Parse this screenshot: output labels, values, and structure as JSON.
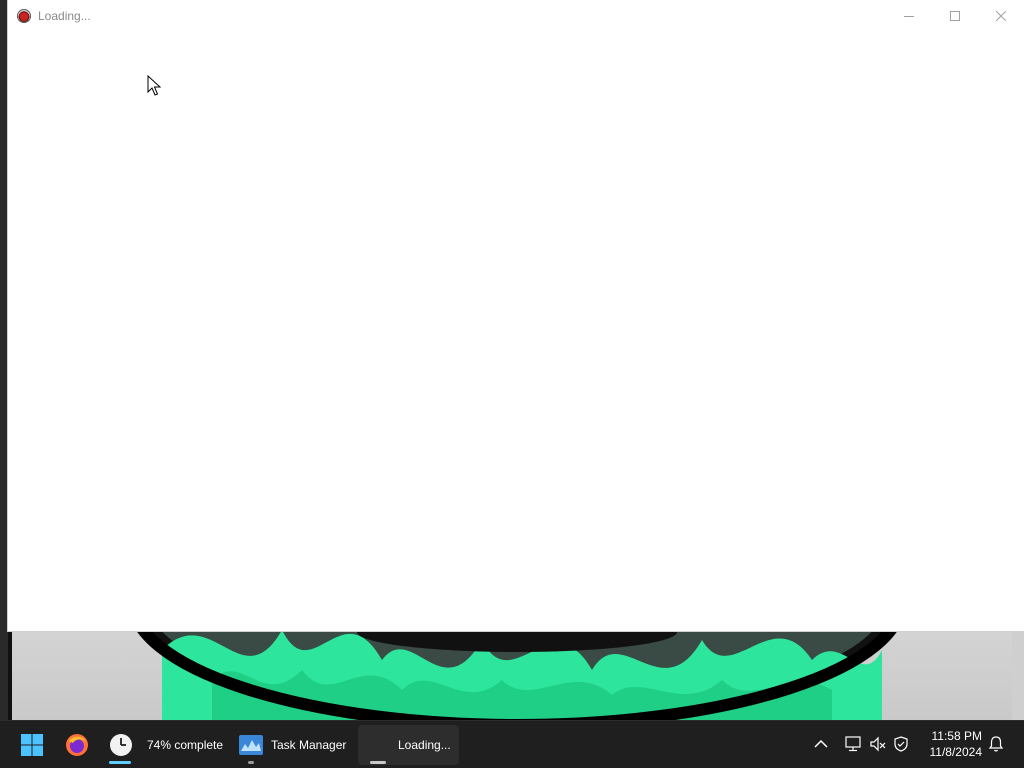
{
  "window": {
    "title": "Loading...",
    "controls": {
      "minimize": "minimize-icon",
      "maximize": "maximize-icon",
      "close": "close-icon"
    }
  },
  "taskbar": {
    "items": [
      {
        "icon": "windows-start-icon",
        "label": ""
      },
      {
        "icon": "firefox-icon",
        "label": ""
      },
      {
        "icon": "clock-icon",
        "label": "74% complete",
        "progress": 0.74
      },
      {
        "icon": "task-manager-icon",
        "label": "Task Manager"
      },
      {
        "icon": "app-loading-icon",
        "label": "Loading..."
      }
    ],
    "tray": {
      "icons": [
        "chevron-up-icon",
        "network-icon",
        "volume-muted-icon",
        "shield-icon",
        "notification-bell-icon"
      ],
      "time": "11:58 PM",
      "date": "11/8/2024"
    }
  },
  "colors": {
    "taskbar_bg": "#1f1f1f",
    "accent": "#60cdff",
    "wallpaper_green": "#2ee59d"
  }
}
